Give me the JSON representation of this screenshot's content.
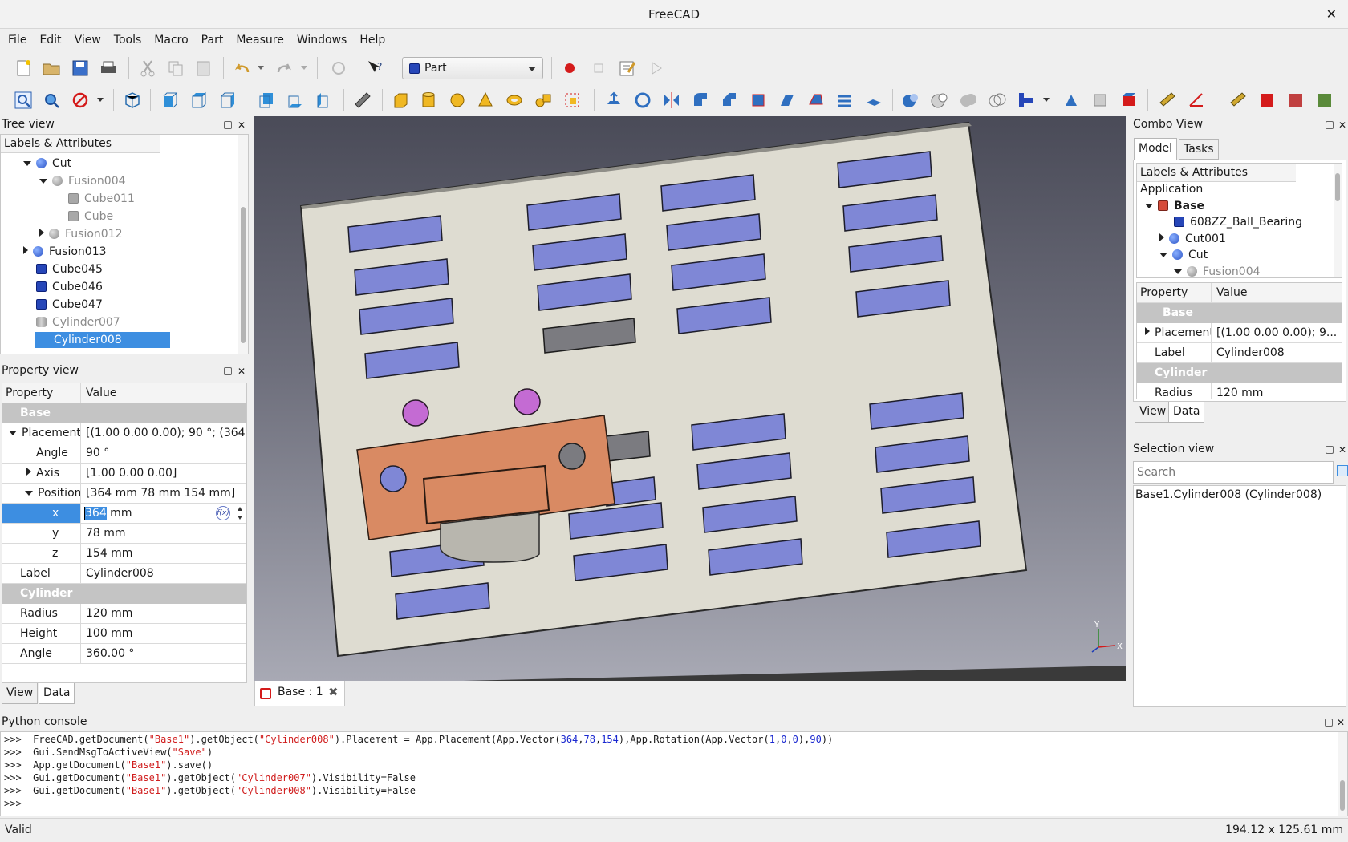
{
  "app": {
    "title": "FreeCAD"
  },
  "menu": [
    "File",
    "Edit",
    "View",
    "Tools",
    "Macro",
    "Part",
    "Measure",
    "Windows",
    "Help"
  ],
  "workbench": {
    "selected": "Part"
  },
  "tree_view": {
    "title": "Tree view",
    "header": "Labels & Attributes",
    "items": [
      {
        "label": "Cut",
        "icon": "cut-icon",
        "expanded": true,
        "indent": 0
      },
      {
        "label": "Fusion004",
        "icon": "fusion-icon",
        "expanded": true,
        "indent": 1,
        "grey": true
      },
      {
        "label": "Cube011",
        "icon": "cube-grey-icon",
        "indent": 2,
        "grey": true
      },
      {
        "label": "Cube",
        "icon": "cube-grey-icon",
        "indent": 2,
        "grey": true
      },
      {
        "label": "Fusion012",
        "icon": "fusion-icon",
        "expanded": false,
        "indent": 1,
        "grey": true
      },
      {
        "label": "Fusion013",
        "icon": "cut-icon",
        "expanded": false,
        "indent": 0
      },
      {
        "label": "Cube045",
        "icon": "cube-icon",
        "indent": 0
      },
      {
        "label": "Cube046",
        "icon": "cube-icon",
        "indent": 0
      },
      {
        "label": "Cube047",
        "icon": "cube-icon",
        "indent": 0
      },
      {
        "label": "Cylinder007",
        "icon": "cylinder-icon",
        "indent": 0,
        "grey": true
      },
      {
        "label": "Cylinder008",
        "icon": "cylinder-icon",
        "indent": 0,
        "selected": true
      }
    ]
  },
  "property_view": {
    "title": "Property view",
    "col_property": "Property",
    "col_value": "Value",
    "group_base": "Base",
    "group_cylinder": "Cylinder",
    "placement": {
      "label": "Placement",
      "value": "[(1.00 0.00 0.00); 90 °; (364 ..."
    },
    "angle": {
      "label": "Angle",
      "value": "90 °"
    },
    "axis": {
      "label": "Axis",
      "value": "[1.00 0.00 0.00]"
    },
    "position": {
      "label": "Position",
      "value": "[364 mm  78 mm  154 mm]"
    },
    "x": {
      "label": "x",
      "selected_text": "364",
      "unit": " mm"
    },
    "y": {
      "label": "y",
      "value": "78 mm"
    },
    "z": {
      "label": "z",
      "value": "154 mm"
    },
    "label_row": {
      "label": "Label",
      "value": "Cylinder008"
    },
    "radius": {
      "label": "Radius",
      "value": "120 mm"
    },
    "height": {
      "label": "Height",
      "value": "100 mm"
    },
    "cyl_angle": {
      "label": "Angle",
      "value": "360.00 °"
    },
    "tab_view": "View",
    "tab_data": "Data"
  },
  "viewport": {
    "tab_label": "Base : 1",
    "axis_x": "X",
    "axis_y": "Y"
  },
  "combo_view": {
    "title": "Combo View",
    "tab_model": "Model",
    "tab_tasks": "Tasks",
    "header": "Labels & Attributes",
    "tree": [
      {
        "label": "Application",
        "indent": 0
      },
      {
        "label": "Base",
        "indent": 0,
        "bold": true,
        "icon": "app-icon"
      },
      {
        "label": "608ZZ_Ball_Bearing",
        "indent": 1,
        "icon": "cube-icon"
      },
      {
        "label": "Cut001",
        "indent": 1,
        "icon": "cut-icon"
      },
      {
        "label": "Cut",
        "indent": 1,
        "icon": "cut-icon"
      },
      {
        "label": "Fusion004",
        "indent": 2,
        "icon": "fusion-icon"
      }
    ],
    "col_property": "Property",
    "col_value": "Value",
    "group_base": "Base",
    "group_cylinder": "Cylinder",
    "placement": {
      "label": "Placement",
      "value": "[(1.00 0.00 0.00); 9..."
    },
    "label_row": {
      "label": "Label",
      "value": "Cylinder008"
    },
    "radius": {
      "label": "Radius",
      "value": "120 mm"
    },
    "tab_view": "View",
    "tab_data": "Data"
  },
  "selection_view": {
    "title": "Selection view",
    "placeholder": "Search",
    "item": "Base1.Cylinder008 (Cylinder008)"
  },
  "python_console": {
    "title": "Python console",
    "prompt": ">>>"
  },
  "status": {
    "left": "Valid",
    "right": "194.12 x 125.61 mm"
  },
  "colors": {
    "selection": "#3d8ee1",
    "pad_blue": "#7f87d6",
    "orange": "#d98a63",
    "plate": "#dedcd1"
  }
}
